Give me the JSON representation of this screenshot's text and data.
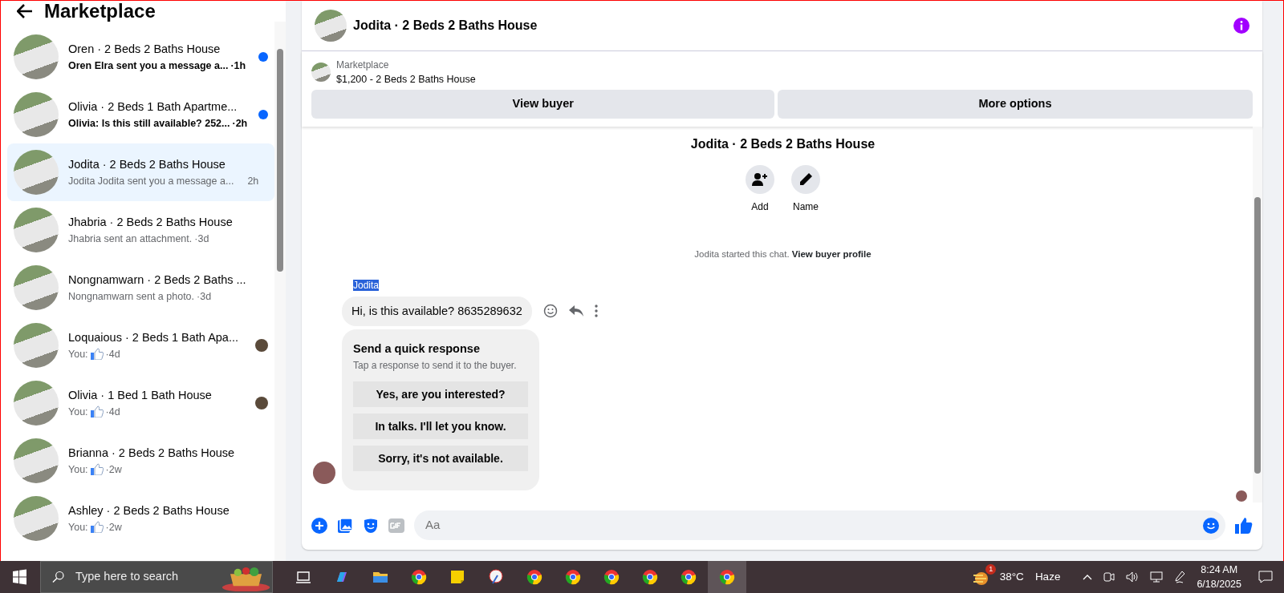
{
  "sidebar": {
    "title": "Marketplace",
    "conversations": [
      {
        "title": "Oren · 2 Beds 2 Baths House",
        "preview": "Oren Elra sent you a message a...",
        "time": "·1h",
        "unread": true,
        "selected": false,
        "seen_avatar": false,
        "like": false
      },
      {
        "title": "Olivia · 2 Beds 1 Bath Apartme...",
        "preview": "Olivia: Is this still available? 252...",
        "time": "·2h",
        "unread": true,
        "selected": false,
        "seen_avatar": false,
        "like": false
      },
      {
        "title": "Jodita · 2 Beds 2 Baths House",
        "preview": "Jodita Jodita sent you a message a...",
        "time": "2h",
        "unread": false,
        "selected": true,
        "seen_avatar": false,
        "like": false
      },
      {
        "title": "Jhabria · 2 Beds 2 Baths House",
        "preview": "Jhabria sent an attachment.",
        "time": "·3d",
        "unread": false,
        "selected": false,
        "seen_avatar": false,
        "like": false
      },
      {
        "title": "Nongnamwarn · 2 Beds 2 Baths ...",
        "preview": "Nongnamwarn sent a photo.",
        "time": "·3d",
        "unread": false,
        "selected": false,
        "seen_avatar": false,
        "like": false
      },
      {
        "title": "Loquaious · 2 Beds 1 Bath Apa...",
        "preview": "You:",
        "time": "·4d",
        "unread": false,
        "selected": false,
        "seen_avatar": true,
        "like": true
      },
      {
        "title": "Olivia · 1 Bed 1 Bath House",
        "preview": "You:",
        "time": "·4d",
        "unread": false,
        "selected": false,
        "seen_avatar": true,
        "like": true
      },
      {
        "title": "Brianna · 2 Beds 2 Baths House",
        "preview": "You:",
        "time": "·2w",
        "unread": false,
        "selected": false,
        "seen_avatar": false,
        "like": true
      },
      {
        "title": "Ashley · 2 Beds 2 Baths House",
        "preview": "You:",
        "time": "·2w",
        "unread": false,
        "selected": false,
        "seen_avatar": false,
        "like": true
      }
    ]
  },
  "chat": {
    "title": "Jodita · 2 Beds 2 Baths House",
    "listing": {
      "label": "Marketplace",
      "price_title": "$1,200 - 2 Beds 2 Baths House"
    },
    "buttons": [
      "View buyer",
      "More options"
    ],
    "profile": {
      "name": "Jodita · 2 Beds 2 Baths House",
      "actions": [
        {
          "kind": "add",
          "label": "Add"
        },
        {
          "kind": "name",
          "label": "Name"
        }
      ]
    },
    "note": {
      "text": "Jodita started this chat.",
      "link": "View buyer profile"
    },
    "sender": {
      "name": "Jodita",
      "highlighted": true
    },
    "message": "Hi, is this available? 8635289632",
    "quick_response": {
      "title": "Send a quick response",
      "subtitle": "Tap a response to send it to the buyer.",
      "options": [
        "Yes, are you interested?",
        "In talks. I'll let you know.",
        "Sorry, it's not available."
      ]
    },
    "composer": {
      "placeholder": "Aa"
    }
  },
  "taskbar": {
    "search_placeholder": "Type here to search",
    "apps": [
      {
        "kind": "taskview",
        "selected": false
      },
      {
        "kind": "copilot",
        "selected": false
      },
      {
        "kind": "folder",
        "selected": false
      },
      {
        "kind": "browser",
        "selected": false
      },
      {
        "kind": "notes",
        "selected": false
      },
      {
        "kind": "paint",
        "selected": false
      },
      {
        "kind": "browser",
        "selected": false
      },
      {
        "kind": "browser",
        "selected": false
      },
      {
        "kind": "browser",
        "selected": false
      },
      {
        "kind": "browser",
        "selected": false
      },
      {
        "kind": "browser",
        "selected": false
      },
      {
        "kind": "browser",
        "selected": true
      }
    ],
    "weather": {
      "badge": "1",
      "temp": "38°C",
      "condition": "Haze"
    },
    "time": "8:24 AM",
    "date": "6/18/2025"
  }
}
